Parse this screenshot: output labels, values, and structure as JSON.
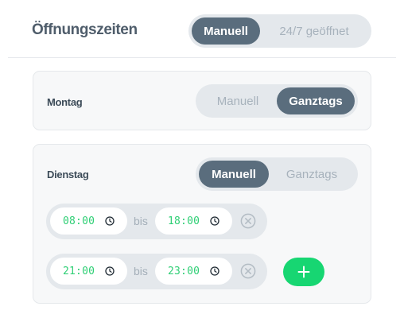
{
  "header": {
    "title": "Öffnungszeiten",
    "mode_options": [
      {
        "label": "Manuell",
        "active": true
      },
      {
        "label": "24/7 geöffnet",
        "active": false
      }
    ]
  },
  "days": [
    {
      "name": "Montag",
      "options": [
        {
          "label": "Manuell",
          "active": false
        },
        {
          "label": "Ganztags",
          "active": true
        }
      ],
      "ranges": []
    },
    {
      "name": "Dienstag",
      "options": [
        {
          "label": "Manuell",
          "active": true
        },
        {
          "label": "Ganztags",
          "active": false
        }
      ],
      "ranges": [
        {
          "from": "08:00",
          "separator": "bis",
          "to": "18:00"
        },
        {
          "from": "21:00",
          "separator": "bis",
          "to": "23:00"
        }
      ]
    }
  ],
  "icons": {
    "time_picker": "clock-icon",
    "remove_range": "close-circle-icon",
    "add_range": "plus-icon"
  },
  "colors": {
    "accent_active": "#5a6d7d",
    "time_text": "#2fcf75",
    "add_button": "#17d672",
    "title": "#4f5d6b"
  }
}
